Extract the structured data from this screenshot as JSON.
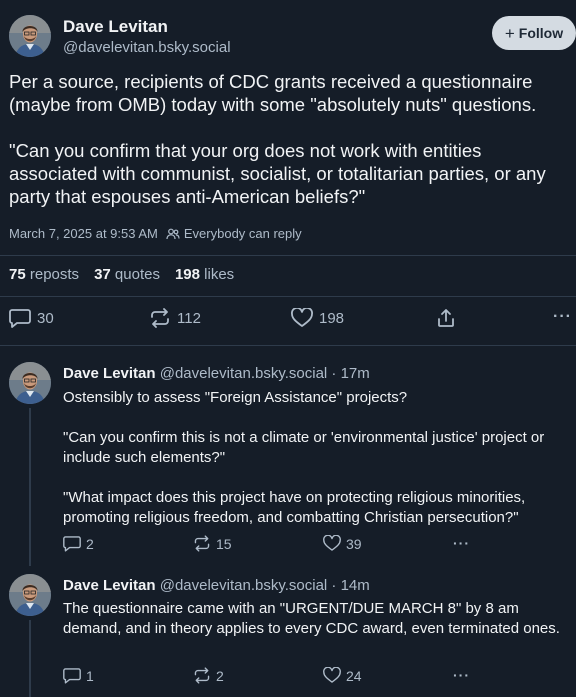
{
  "post": {
    "author_name": "Dave Levitan",
    "author_handle": "@davelevitan.bsky.social",
    "follow_label": "Follow",
    "text": "Per a source, recipients of CDC grants received a questionnaire (maybe from OMB) today with some \"absolutely nuts\" questions.\n\n\"Can you confirm that your org does not work with entities associated with communist, socialist, or totalitarian parties, or any party that espouses anti-American beliefs?\"",
    "timestamp": "March 7, 2025 at 9:53 AM",
    "reply_setting": "Everybody can reply",
    "stats": {
      "reposts_count": "75",
      "reposts_label": "reposts",
      "quotes_count": "37",
      "quotes_label": "quotes",
      "likes_count": "198",
      "likes_label": "likes"
    },
    "actions": {
      "replies": "30",
      "reposts": "112",
      "likes": "198"
    }
  },
  "replies": [
    {
      "author_name": "Dave Levitan",
      "author_handle": "@davelevitan.bsky.social",
      "age": "· 17m",
      "text": "Ostensibly to assess \"Foreign Assistance\" projects?\n\n\"Can you confirm this is not a climate or 'environmental justice' project or include such elements?\"\n\n\"What impact does this project have on protecting religious minorities, promoting religious freedom, and combatting Christian persecution?\"",
      "replies": "2",
      "reposts": "15",
      "likes": "39"
    },
    {
      "author_name": "Dave Levitan",
      "author_handle": "@davelevitan.bsky.social",
      "age": "· 14m",
      "text": "The questionnaire came with an \"URGENT/DUE MARCH 8\" by 8 am demand, and in theory applies to every CDC award, even terminated ones.",
      "replies": "1",
      "reposts": "2",
      "likes": "24"
    }
  ],
  "icons": {
    "reply": "speech-bubble-icon",
    "repost": "repost-arrows-icon",
    "like": "heart-icon",
    "share": "share-icon",
    "more": "more-dots-icon",
    "people": "people-icon"
  },
  "colors": {
    "background": "#151d28",
    "text": "#f1f3f5",
    "muted": "#aebbc9",
    "divider": "#2e3b4b",
    "follow_button": "#d4dbe2"
  }
}
